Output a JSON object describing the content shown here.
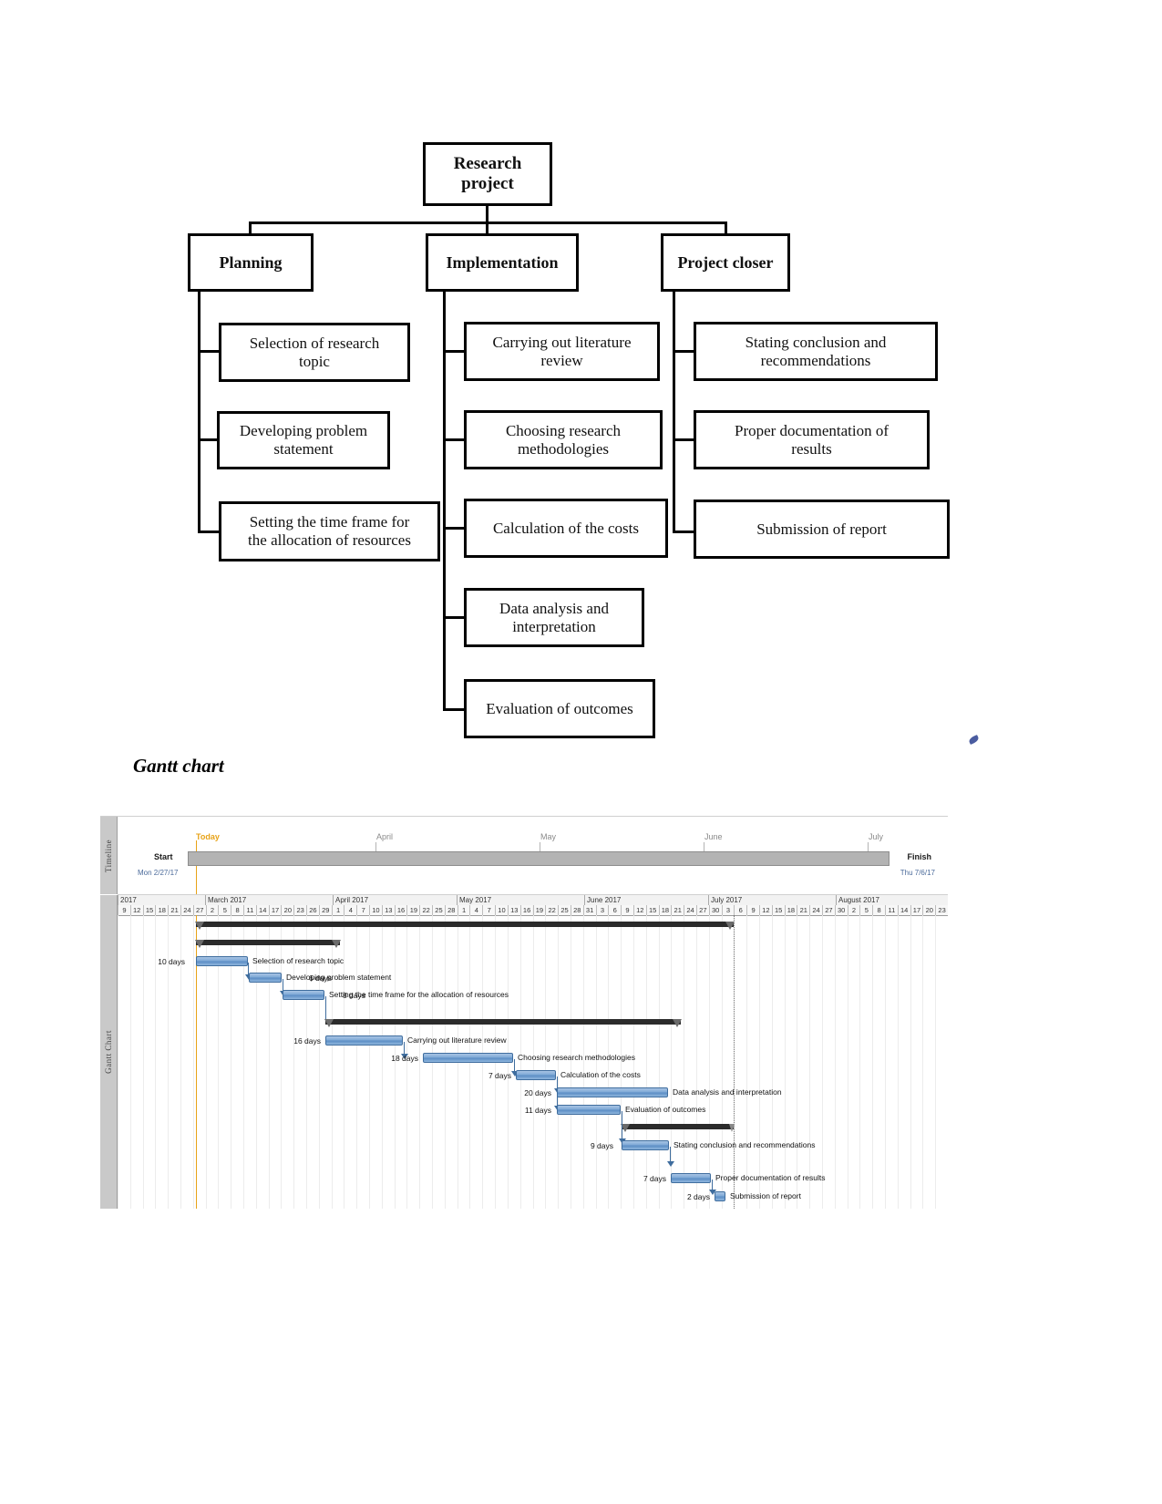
{
  "wbs": {
    "root": {
      "label": "Research\nproject"
    },
    "branches": [
      {
        "label": "Planning",
        "children": [
          "Selection of research\ntopic",
          "Developing problem\nstatement",
          "Setting the time frame for\nthe allocation of resources"
        ]
      },
      {
        "label": "Implementation",
        "children": [
          "Carrying out literature\nreview",
          "Choosing research\nmethodologies",
          "Calculation of the costs",
          "Data analysis and\ninterpretation",
          "Evaluation of outcomes"
        ]
      },
      {
        "label": "Project closer",
        "children": [
          "Stating conclusion and\nrecommendations",
          "Proper documentation of\nresults",
          "Submission of report"
        ]
      }
    ]
  },
  "section_title": "Gantt chart",
  "gantt": {
    "side_tabs": {
      "timeline": "Timeline",
      "gantt": "Gantt Chart"
    },
    "timeline": {
      "today_label": "Today",
      "start_label": "Start",
      "finish_label": "Finish",
      "start_date": "Mon 2/27/17",
      "finish_date": "Thu 7/6/17",
      "month_ticks": [
        "April",
        "May",
        "June",
        "July"
      ]
    },
    "scale": {
      "months": [
        "2017",
        "March 2017",
        "April 2017",
        "May 2017",
        "June 2017",
        "July 2017",
        "August 2017"
      ],
      "days": [
        "9",
        "12",
        "15",
        "18",
        "21",
        "24",
        "27",
        "2",
        "5",
        "8",
        "11",
        "14",
        "17",
        "20",
        "23",
        "26",
        "29",
        "1",
        "4",
        "7",
        "10",
        "13",
        "16",
        "19",
        "22",
        "25",
        "28",
        "1",
        "4",
        "7",
        "10",
        "13",
        "16",
        "19",
        "22",
        "25",
        "28",
        "31",
        "3",
        "6",
        "9",
        "12",
        "15",
        "18",
        "21",
        "24",
        "27",
        "30",
        "3",
        "6",
        "9",
        "12",
        "15",
        "18",
        "21",
        "24",
        "27",
        "30",
        "2",
        "5",
        "8",
        "11",
        "14",
        "17",
        "20",
        "23"
      ]
    },
    "colors": {
      "task_bar": "#5b8dc4",
      "task_border": "#3f6d9e",
      "summary_bar": "#2b2b2b",
      "today_line": "#e8a317",
      "timeline_bar": "#b3b3b3"
    },
    "tasks": [
      {
        "name": "Selection of research topic",
        "duration": "10 days"
      },
      {
        "name": "Developing problem statement",
        "duration": "6 days"
      },
      {
        "name": "Setting the time frame for the allocation of resources",
        "duration": "8 days"
      },
      {
        "name": "Carrying out literature review",
        "duration": "16 days"
      },
      {
        "name": "Choosing research methodologies",
        "duration": "18 days"
      },
      {
        "name": "Calculation of the costs",
        "duration": "7 days"
      },
      {
        "name": "Data analysis and interpretation",
        "duration": "20 days"
      },
      {
        "name": "Evaluation of outcomes",
        "duration": "11 days"
      },
      {
        "name": "Stating conclusion and recommendations",
        "duration": "9 days"
      },
      {
        "name": "Proper documentation of results",
        "duration": "7 days"
      },
      {
        "name": "Submission of report",
        "duration": "2 days"
      }
    ]
  }
}
